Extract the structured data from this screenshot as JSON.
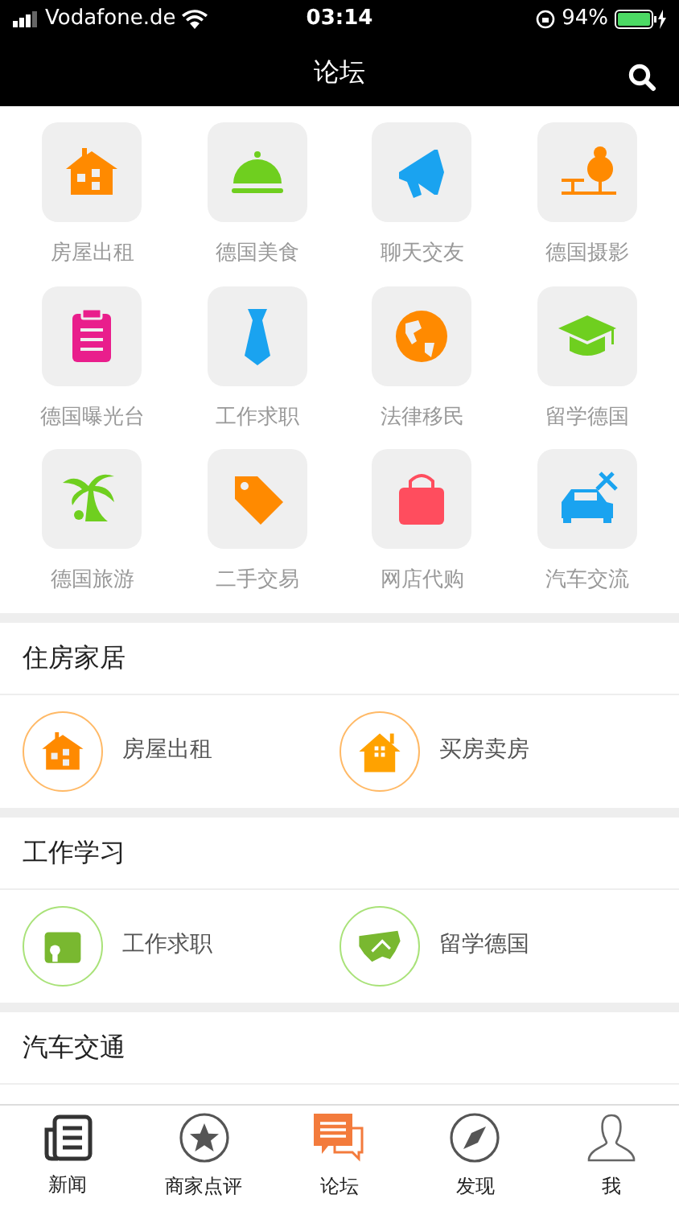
{
  "status_bar": {
    "carrier": "Vodafone.de",
    "time": "03:14",
    "battery": "94%"
  },
  "nav": {
    "title": "论坛"
  },
  "categories": [
    {
      "label": "房屋出租"
    },
    {
      "label": "德国美食"
    },
    {
      "label": "聊天交友"
    },
    {
      "label": "德国摄影"
    },
    {
      "label": "德国曝光台"
    },
    {
      "label": "工作求职"
    },
    {
      "label": "法律移民"
    },
    {
      "label": "留学德国"
    },
    {
      "label": "德国旅游"
    },
    {
      "label": "二手交易"
    },
    {
      "label": "网店代购"
    },
    {
      "label": "汽车交流"
    }
  ],
  "sections": [
    {
      "title": "住房家居",
      "items": [
        {
          "label": "房屋出租"
        },
        {
          "label": "买房卖房"
        }
      ]
    },
    {
      "title": "工作学习",
      "items": [
        {
          "label": "工作求职"
        },
        {
          "label": "留学德国"
        }
      ]
    },
    {
      "title": "汽车交通"
    }
  ],
  "tabs": [
    {
      "label": "新闻",
      "selected": false
    },
    {
      "label": "商家点评",
      "selected": false
    },
    {
      "label": "论坛",
      "selected": true
    },
    {
      "label": "发现",
      "selected": false
    },
    {
      "label": "我",
      "selected": false
    }
  ]
}
